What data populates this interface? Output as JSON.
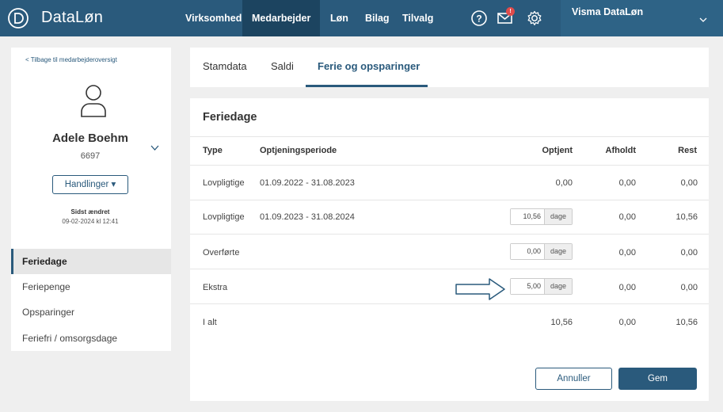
{
  "brand": {
    "name": "DataLøn"
  },
  "nav": {
    "items": [
      {
        "label": "Virksomhed"
      },
      {
        "label": "Medarbejder"
      },
      {
        "label": "Løn"
      },
      {
        "label": "Bilag"
      },
      {
        "label": "Tilvalg"
      }
    ],
    "active": "Medarbejder",
    "mail_badge": "!",
    "user": "Visma DataLøn"
  },
  "sidebar": {
    "back_link": "< Tilbage til medarbejderoversigt",
    "employee_name": "Adele Boehm",
    "employee_number": "6697",
    "actions_label": "Handlinger ▾",
    "changed_label": "Sidst ændret",
    "changed_date": "09-02-2024 kl 12:41",
    "items": [
      {
        "label": "Feriedage"
      },
      {
        "label": "Feriepenge"
      },
      {
        "label": "Opsparinger"
      },
      {
        "label": "Feriefri / omsorgsdage"
      }
    ]
  },
  "tabs": [
    {
      "label": "Stamdata"
    },
    {
      "label": "Saldi"
    },
    {
      "label": "Ferie og opsparinger"
    }
  ],
  "card": {
    "title": "Feriedage",
    "headers": {
      "type": "Type",
      "period": "Optjeningsperiode",
      "earned": "Optjent",
      "held": "Afholdt",
      "rest": "Rest"
    },
    "rows": [
      {
        "type": "Lovpligtige",
        "period": "01.09.2022 - 31.08.2023",
        "earned": "0,00",
        "held": "0,00",
        "rest": "0,00"
      },
      {
        "type": "Lovpligtige",
        "period": "01.09.2023 - 31.08.2024",
        "earned": "10,56",
        "unit": "dage",
        "held": "0,00",
        "rest": "10,56"
      },
      {
        "type": "Overførte",
        "period": "",
        "earned": "0,00",
        "unit": "dage",
        "held": "0,00",
        "rest": "0,00"
      },
      {
        "type": "Ekstra",
        "period": "",
        "earned": "5,00",
        "unit": "dage",
        "held": "0,00",
        "rest": "0,00"
      },
      {
        "type": "I alt",
        "period": "",
        "earned": "10,56",
        "held": "0,00",
        "rest": "10,56"
      }
    ],
    "cancel_label": "Annuller",
    "save_label": "Gem"
  },
  "colors": {
    "primary": "#2a5a7c",
    "active_nav": "#1c4460",
    "badge": "#e04b4b"
  }
}
